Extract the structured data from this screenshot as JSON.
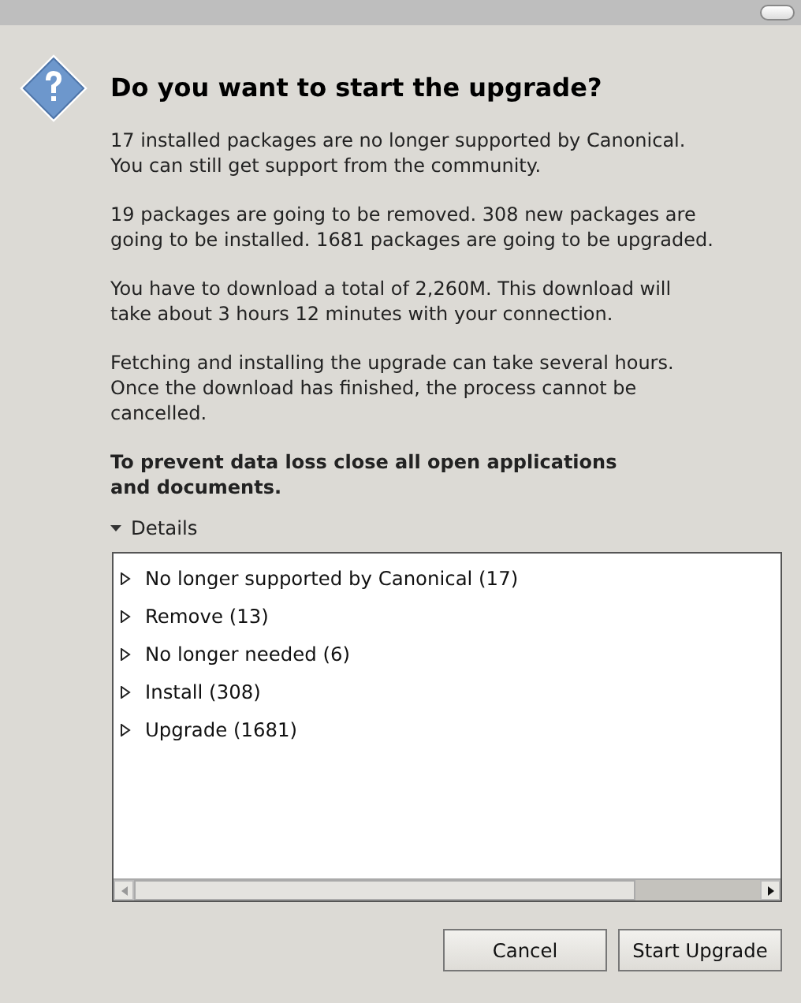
{
  "title": "Do you want to start the upgrade?",
  "paragraphs": [
    {
      "text": "17 installed packages are no longer supported by Canonical. You can still get support from the community.",
      "bold": false
    },
    {
      "text": "19 packages are going to be removed. 308 new packages are going to be installed. 1681 packages are going to be upgraded.",
      "bold": false
    },
    {
      "text": "You have to download a total of 2,260M. This download will take about 3 hours 12 minutes with your connection.",
      "bold": false
    },
    {
      "text": "Fetching and installing the upgrade can take several hours. Once the download has finished, the process cannot be cancelled.",
      "bold": false
    },
    {
      "text": "To prevent data loss close all open applications and documents.",
      "bold": true
    }
  ],
  "details": {
    "label": "Details",
    "expanded": true
  },
  "tree": [
    {
      "label": "No longer supported by Canonical (17)",
      "expanded": false
    },
    {
      "label": "Remove (13)",
      "expanded": false
    },
    {
      "label": "No longer needed (6)",
      "expanded": false
    },
    {
      "label": "Install (308)",
      "expanded": false
    },
    {
      "label": "Upgrade (1681)",
      "expanded": false
    }
  ],
  "buttons": [
    "Cancel",
    "Start Upgrade"
  ]
}
